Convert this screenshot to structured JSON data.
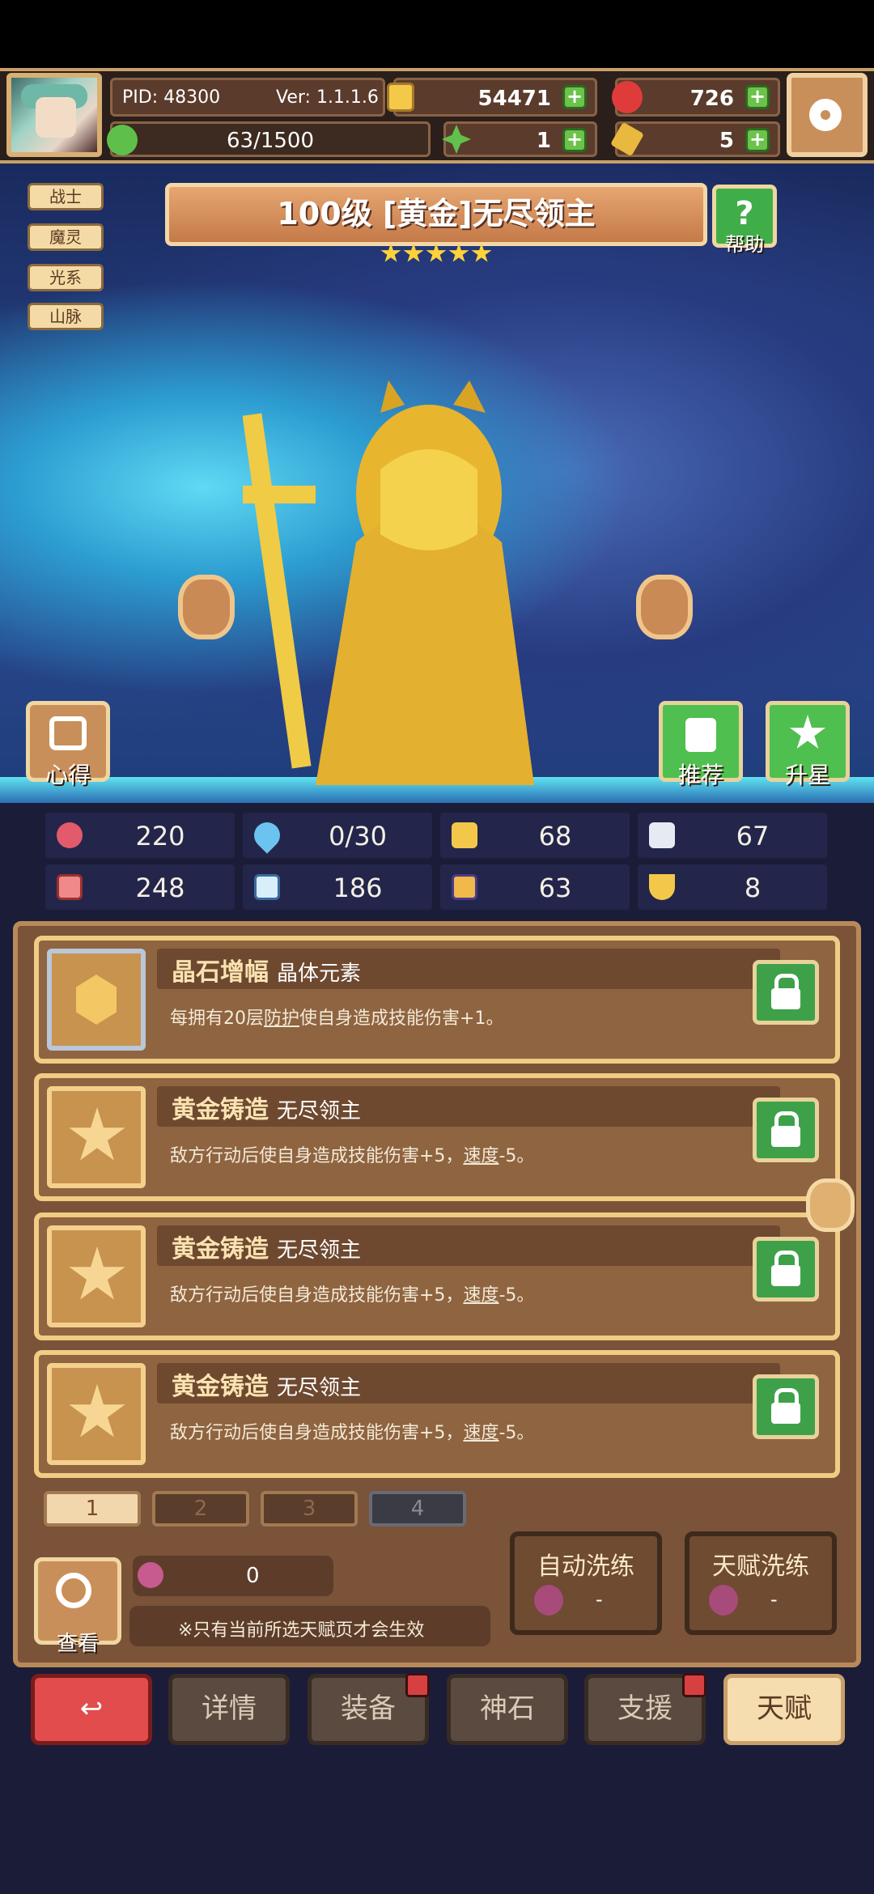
{
  "header": {
    "pid": "PID: 48300",
    "version": "Ver: 1.1.1.6",
    "exp": "63/1500",
    "gold": "54471",
    "gems": "726",
    "clover": "1",
    "key": "5"
  },
  "tags": [
    "战士",
    "魔灵",
    "光系",
    "山脉"
  ],
  "title": "100级  [黄金]无尽领主",
  "help_label": "帮助",
  "stars": 5,
  "buttons": {
    "insight": "心得",
    "recommend": "推荐",
    "star_up": "升星"
  },
  "stats": [
    "220",
    "0/30",
    "68",
    "67",
    "248",
    "186",
    "63",
    "8"
  ],
  "talents": [
    {
      "name": "晶石增幅",
      "sub": "晶体元素",
      "desc_pre": "每拥有20层",
      "desc_link": "防护",
      "desc_post": "使自身造成技能伤害+1。"
    },
    {
      "name": "黄金铸造",
      "sub": "无尽领主",
      "desc_pre": "敌方行动后使自身造成技能伤害+5，",
      "desc_link": "速度",
      "desc_post": "-5。"
    },
    {
      "name": "黄金铸造",
      "sub": "无尽领主",
      "desc_pre": "敌方行动后使自身造成技能伤害+5，",
      "desc_link": "速度",
      "desc_post": "-5。"
    },
    {
      "name": "黄金铸造",
      "sub": "无尽领主",
      "desc_pre": "敌方行动后使自身造成技能伤害+5，",
      "desc_link": "速度",
      "desc_post": "-5。"
    }
  ],
  "pages": [
    "1",
    "2",
    "3",
    "4"
  ],
  "view_label": "查看",
  "potion_count": "0",
  "notice": "※只有当前所选天赋页才会生效",
  "auto_refine": {
    "label": "自动洗练",
    "cost": "-"
  },
  "talent_refine": {
    "label": "天赋洗练",
    "cost": "-"
  },
  "nav": {
    "details": "详情",
    "equip": "装备",
    "godstone": "神石",
    "support": "支援",
    "talent": "天赋"
  },
  "colors": {
    "accent": "#f0cc84",
    "panel": "#7a5338",
    "nav_active": "#f6ddb0",
    "back": "#e24c4c"
  }
}
